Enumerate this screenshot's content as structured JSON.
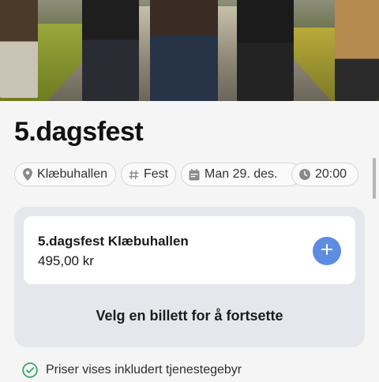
{
  "event": {
    "title": "5.dagsfest"
  },
  "chips": {
    "venue": {
      "icon": "location-pin-icon",
      "label": "Klæbuhallen"
    },
    "category": {
      "icon": "hashtag-icon",
      "label": "Fest"
    },
    "date": {
      "icon": "calendar-icon",
      "label": "Man 29. des."
    },
    "time": {
      "icon": "clock-icon",
      "label": "20:00"
    }
  },
  "ticket": {
    "name": "5.dagsfest Klæbuhallen",
    "price": "495,00 kr",
    "add_icon": "plus-icon"
  },
  "cta": {
    "label": "Velg en billett for å fortsette"
  },
  "notice": {
    "icon": "check-circle-icon",
    "text": "Priser vises inkludert tjenestegebyr"
  },
  "colors": {
    "accent": "#5d8de0",
    "check": "#3aa66a",
    "panel": "#e6e7ec"
  }
}
